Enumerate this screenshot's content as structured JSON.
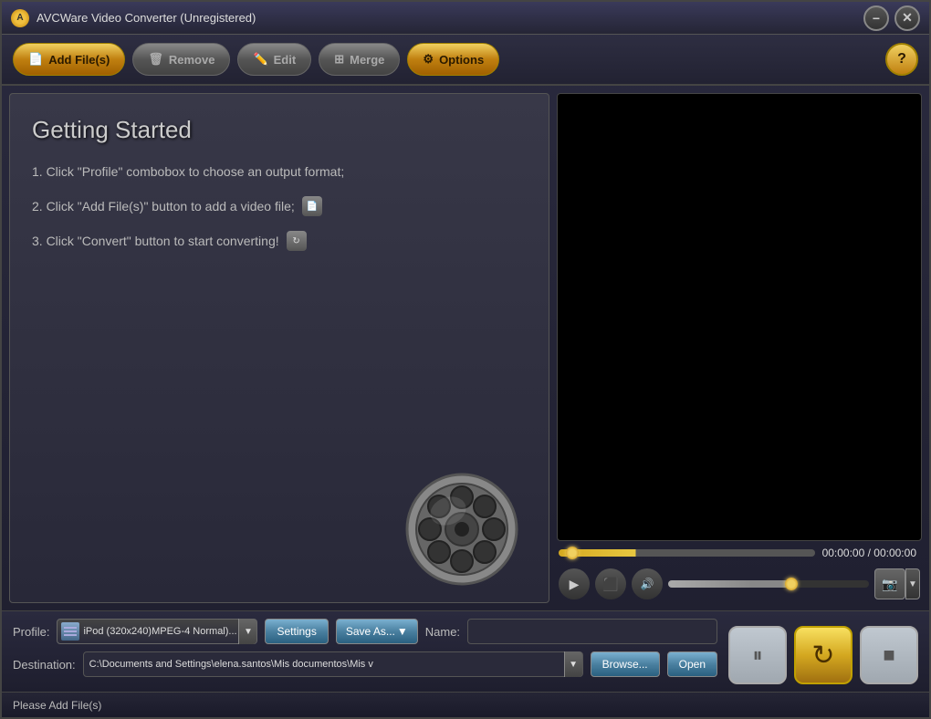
{
  "titleBar": {
    "title": "AVCWare Video Converter (Unregistered)",
    "minimizeLabel": "−",
    "closeLabel": "✕"
  },
  "toolbar": {
    "addFilesLabel": "Add File(s)",
    "removeLabel": "Remove",
    "editLabel": "Edit",
    "mergeLabel": "Merge",
    "optionsLabel": "Options",
    "helpLabel": "?"
  },
  "gettingStarted": {
    "title": "Getting Started",
    "step1": "1. Click \"Profile\" combobox to choose an output format;",
    "step2": "2. Click \"Add File(s)\" button to add a video file;",
    "step3": "3. Click \"Convert\" button to start converting!"
  },
  "videoPlayer": {
    "timeDisplay": "00:00:00 / 00:00:00"
  },
  "profile": {
    "label": "Profile:",
    "selectedValue": "iPod (320x240)MPEG-4 Normal)...",
    "settingsLabel": "Settings",
    "saveAsLabel": "Save As...",
    "nameLabel": "Name:",
    "nameValue": ""
  },
  "destination": {
    "label": "Destination:",
    "path": "C:\\Documents and Settings\\elena.santos\\Mis documentos\\Mis v",
    "browseLabel": "Browse...",
    "openLabel": "Open"
  },
  "controls": {
    "pauseLabel": "⏸",
    "convertLabel": "↻",
    "stopLabel": "■"
  },
  "statusBar": {
    "message": "Please Add File(s)"
  }
}
